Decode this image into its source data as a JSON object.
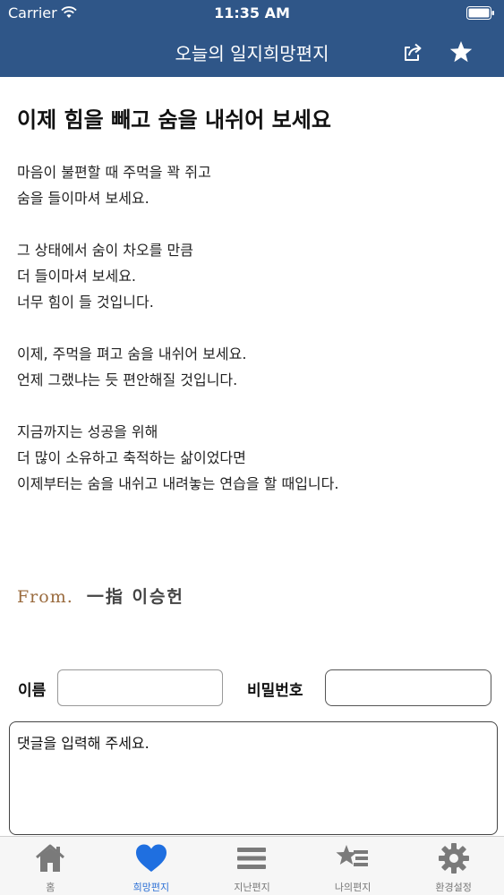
{
  "status_bar": {
    "carrier": "Carrier",
    "time": "11:35 AM"
  },
  "nav": {
    "title": "오늘의 일지희망편지",
    "share_icon": "share-icon",
    "star_icon": "star-icon"
  },
  "letter": {
    "title": "이제 힘을 빼고 숨을 내쉬어 보세요",
    "paragraphs": [
      [
        "마음이 불편할 때 주먹을 꽉 쥐고",
        "숨을 들이마셔 보세요."
      ],
      [
        "그 상태에서 숨이 차오를 만큼",
        "더 들이마셔 보세요.",
        "너무 힘이 들 것입니다."
      ],
      [
        "이제, 주먹을 펴고 숨을 내쉬어 보세요.",
        "언제 그랬냐는 듯 편안해질 것입니다."
      ],
      [
        "지금까지는 성공을 위해",
        "더 많이 소유하고 축적하는 삶이었다면",
        "이제부터는 숨을 내쉬고 내려놓는 연습을 할 때입니다."
      ]
    ],
    "signature_from": "From.",
    "signature_name": "一指 이승헌"
  },
  "form": {
    "name_label": "이름",
    "name_value": "",
    "password_label": "비밀번호",
    "password_value": "",
    "comment_placeholder": "댓글을 입력해 주세요."
  },
  "tabs": [
    {
      "label": "홈",
      "icon": "home-icon",
      "active": false
    },
    {
      "label": "희망편지",
      "icon": "heart-icon",
      "active": true
    },
    {
      "label": "지난편지",
      "icon": "list-icon",
      "active": false
    },
    {
      "label": "나의편지",
      "icon": "starred-list-icon",
      "active": false
    },
    {
      "label": "환경설정",
      "icon": "gear-icon",
      "active": false
    }
  ],
  "colors": {
    "header_bg": "#2f5688",
    "tab_active": "#2f72d6",
    "tab_inactive": "#777777"
  }
}
